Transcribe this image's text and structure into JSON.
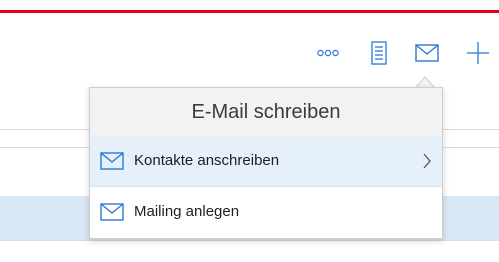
{
  "colors": {
    "brand_red": "#e2001a",
    "accent_blue": "#2b78d3",
    "icon_gray": "#6b6b6b",
    "selected_row": "#e6f0fa",
    "band_light_blue": "#d9e8f7"
  },
  "toolbar": {
    "items": [
      {
        "icon": "more-icon"
      },
      {
        "icon": "notes-icon"
      },
      {
        "icon": "mail-icon"
      },
      {
        "icon": "add-icon"
      }
    ]
  },
  "flyout": {
    "title": "E-Mail schreiben",
    "items": [
      {
        "label": "Kontakte anschreiben",
        "icon": "mail-icon",
        "has_submenu": true,
        "highlighted": true
      },
      {
        "label": "Mailing anlegen",
        "icon": "mail-icon",
        "has_submenu": false,
        "highlighted": false
      }
    ]
  }
}
